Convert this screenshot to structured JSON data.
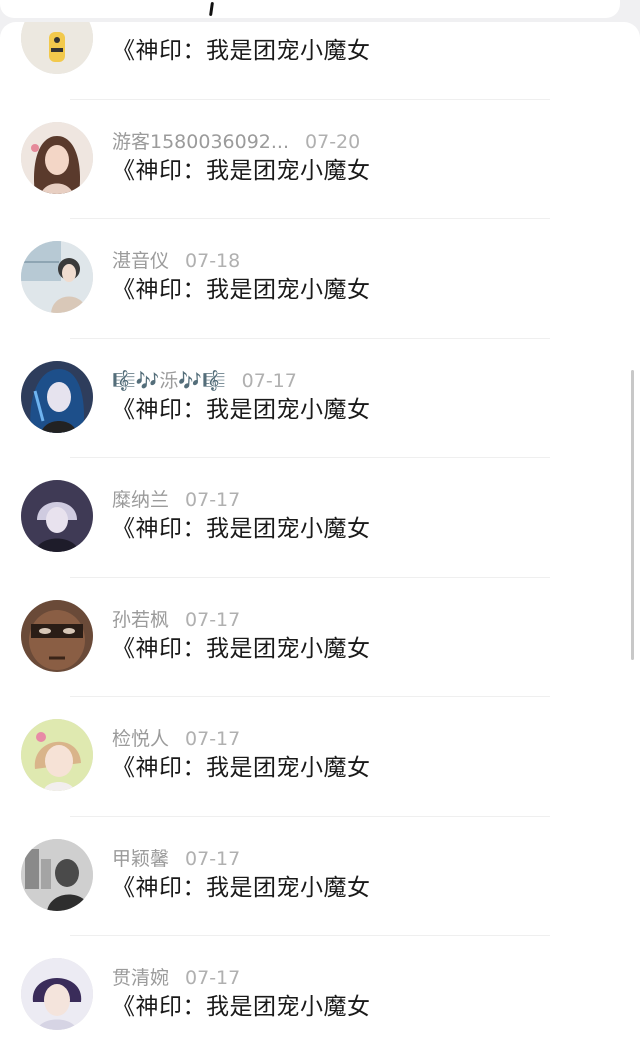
{
  "comments": [
    {
      "username": "",
      "date": "",
      "text": "《神印：我是团宠小魔女",
      "avatar": "cartoon-yellow-avatar",
      "avatar_color": "#e8e2d6"
    },
    {
      "username": "游客1580036092...",
      "date": "07-20",
      "text": "《神印：我是团宠小魔女",
      "avatar": "girl-selfie-avatar",
      "avatar_color": "#d9b8a8"
    },
    {
      "username": "湛音仪",
      "date": "07-18",
      "text": "《神印：我是团宠小魔女",
      "avatar": "anime-girl-window-avatar",
      "avatar_color": "#c9d2d6"
    },
    {
      "username": "🎼🎶泺🎶🎼",
      "date": "07-17",
      "text": "《神印：我是团宠小魔女",
      "avatar": "anime-blue-hair-avatar",
      "avatar_color": "#3d5a8a"
    },
    {
      "username": "糜纳兰",
      "date": "07-17",
      "text": "《神印：我是团宠小魔女",
      "avatar": "anime-dark-boy-avatar",
      "avatar_color": "#4a4560"
    },
    {
      "username": "孙若枫",
      "date": "07-17",
      "text": "《神印：我是团宠小魔女",
      "avatar": "face-close-up-avatar",
      "avatar_color": "#7a5a45"
    },
    {
      "username": "检悦人",
      "date": "07-17",
      "text": "《神印：我是团宠小魔女",
      "avatar": "little-girl-avatar",
      "avatar_color": "#d8e6a8"
    },
    {
      "username": "甲颖馨",
      "date": "07-17",
      "text": "《神印：我是团宠小魔女",
      "avatar": "bw-photo-avatar",
      "avatar_color": "#9a9a9a"
    },
    {
      "username": "贯清婉",
      "date": "07-17",
      "text": "《神印：我是团宠小魔女",
      "avatar": "anime-boy-avatar",
      "avatar_color": "#6a5a8a"
    }
  ]
}
